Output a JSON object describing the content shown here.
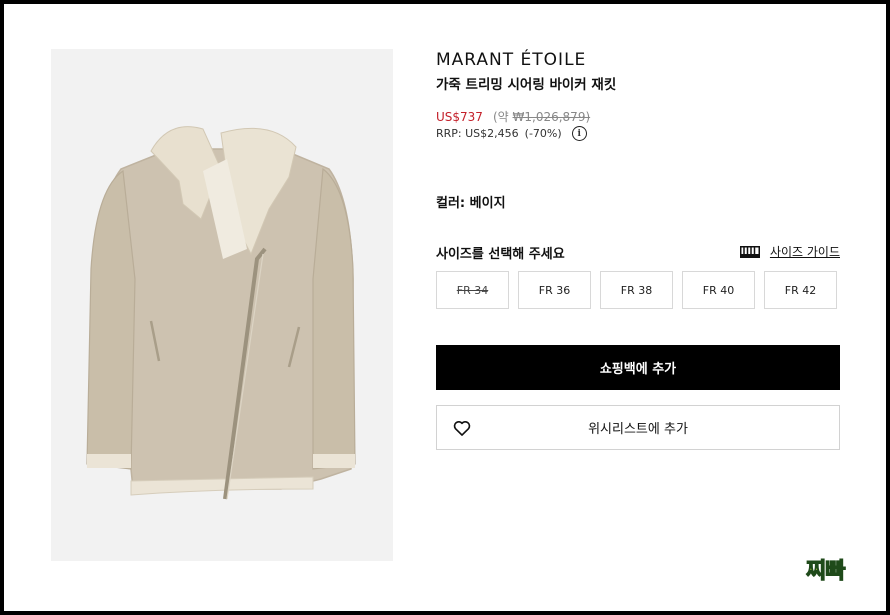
{
  "product": {
    "brand": "MARANT ÉTOILE",
    "name": "가죽 트리밍 시어링 바이커 재킷",
    "sale_price": "US$737",
    "approx_prefix": "(약",
    "approx_krw": "₩1,026,879)",
    "rrp": "RRP: US$2,456",
    "discount": "(-70%)",
    "info_icon": "info-icon",
    "color_label": "컬러: 베이지"
  },
  "size": {
    "prompt": "사이즈를 선택해 주세요",
    "guide_label": "사이즈 가이드",
    "guide_icon": "ruler-icon",
    "options": [
      {
        "label": "FR 34",
        "available": false
      },
      {
        "label": "FR 36",
        "available": true
      },
      {
        "label": "FR 38",
        "available": true
      },
      {
        "label": "FR 40",
        "available": true
      },
      {
        "label": "FR 42",
        "available": true
      }
    ]
  },
  "actions": {
    "add_to_bag": "쇼핑백에 추가",
    "add_to_wishlist": "위시리스트에 추가",
    "wishlist_icon": "heart-icon"
  },
  "watermark": "찌빠",
  "colors": {
    "sale": "#c4202a",
    "button_bg": "#000000",
    "jacket": "#cfc4b2",
    "shearling": "#e9e2d3"
  }
}
